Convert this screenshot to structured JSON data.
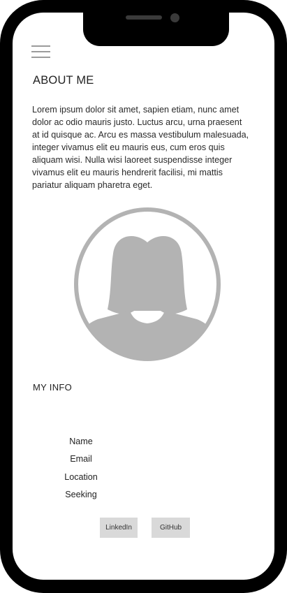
{
  "about": {
    "title": "ABOUT ME",
    "text": "Lorem ipsum dolor sit amet, sapien etiam, nunc amet dolor ac odio mauris justo. Luctus arcu, urna praesent at id quisque ac. Arcu es massa vestibulum malesuada, integer vivamus elit eu mauris eus, cum eros quis aliquam wisi. Nulla wisi laoreet suspendisse integer vivamus elit eu mauris hendrerit facilisi, mi mattis pariatur aliquam pharetra eget."
  },
  "info": {
    "title": "MY INFO",
    "items": [
      "Name",
      "Email",
      "Location",
      "Seeking"
    ]
  },
  "buttons": {
    "linkedin": "LinkedIn",
    "github": "GitHub"
  },
  "icons": {
    "menu": "hamburger-menu-icon",
    "avatar": "profile-avatar-icon"
  },
  "colors": {
    "avatar_gray": "#b3b3b3",
    "button_bg": "#d9d9d9"
  }
}
